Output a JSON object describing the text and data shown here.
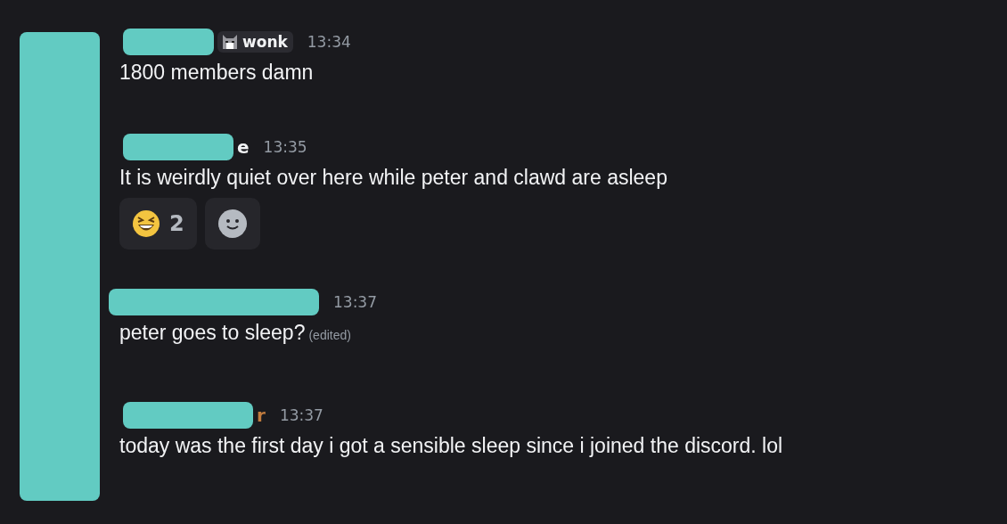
{
  "messages": [
    {
      "badge": {
        "label": "wonk"
      },
      "time": "13:34",
      "text": "1800 members damn"
    },
    {
      "name_end": "e",
      "color": "#f2f3f5",
      "time": "13:35",
      "text": "It is weirdly quiet over here while peter and clawd are asleep",
      "reactions": [
        {
          "kind": "laughing",
          "count": "2"
        },
        {
          "kind": "add"
        }
      ]
    },
    {
      "time": "13:37",
      "text": "peter goes to sleep?",
      "edited_label": "(edited)"
    },
    {
      "name_end": "r",
      "color": "#c27c3e",
      "time": "13:37",
      "text": "today was the first day i got a sensible sleep since i joined the discord. lol"
    }
  ]
}
